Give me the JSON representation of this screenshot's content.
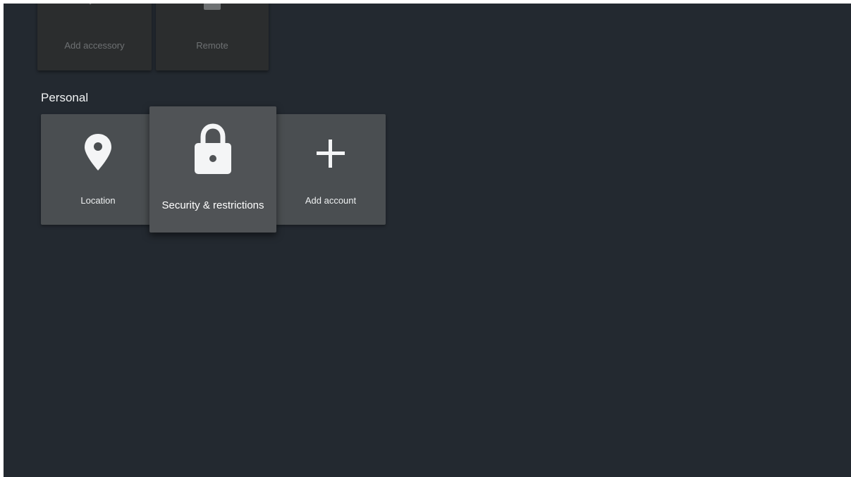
{
  "hardware_row": {
    "items": [
      {
        "label": "Add accessory",
        "icon": "bluetooth-icon"
      },
      {
        "label": "Remote",
        "icon": "remote-icon"
      }
    ]
  },
  "personal": {
    "title": "Personal",
    "items": [
      {
        "label": "Location",
        "icon": "location-pin-icon"
      },
      {
        "label": "Security & restrictions",
        "icon": "lock-icon",
        "focused": true
      },
      {
        "label": "Add account",
        "icon": "plus-icon"
      }
    ]
  },
  "colors": {
    "background": "#232930",
    "card": "#4a4e51",
    "card_dim": "#2b2d2e",
    "text": "#eef0f1"
  }
}
